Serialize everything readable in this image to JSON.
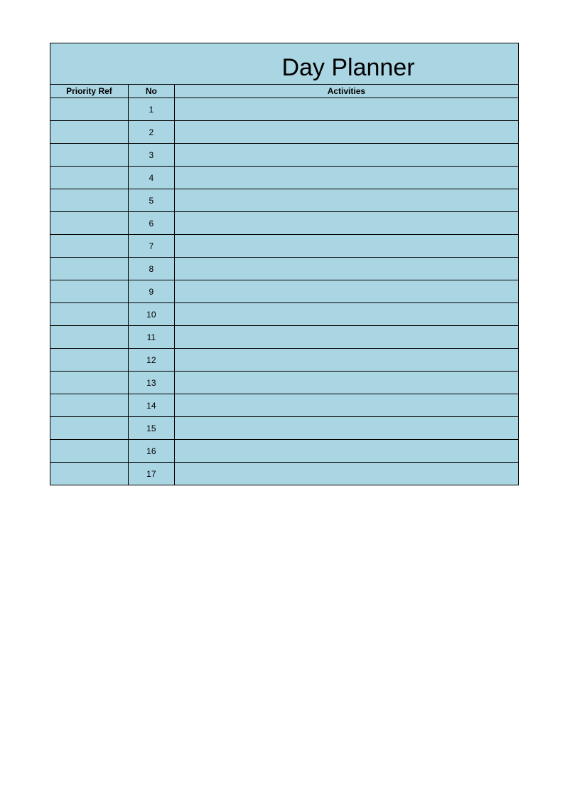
{
  "title": "Day Planner",
  "columns": {
    "priority": "Priority Ref",
    "no": "No",
    "activities": "Activities"
  },
  "rows": [
    {
      "priority": "",
      "no": "1",
      "activities": ""
    },
    {
      "priority": "",
      "no": "2",
      "activities": ""
    },
    {
      "priority": "",
      "no": "3",
      "activities": ""
    },
    {
      "priority": "",
      "no": "4",
      "activities": ""
    },
    {
      "priority": "",
      "no": "5",
      "activities": ""
    },
    {
      "priority": "",
      "no": "6",
      "activities": ""
    },
    {
      "priority": "",
      "no": "7",
      "activities": ""
    },
    {
      "priority": "",
      "no": "8",
      "activities": ""
    },
    {
      "priority": "",
      "no": "9",
      "activities": ""
    },
    {
      "priority": "",
      "no": "10",
      "activities": ""
    },
    {
      "priority": "",
      "no": "11",
      "activities": ""
    },
    {
      "priority": "",
      "no": "12",
      "activities": ""
    },
    {
      "priority": "",
      "no": "13",
      "activities": ""
    },
    {
      "priority": "",
      "no": "14",
      "activities": ""
    },
    {
      "priority": "",
      "no": "15",
      "activities": ""
    },
    {
      "priority": "",
      "no": "16",
      "activities": ""
    },
    {
      "priority": "",
      "no": "17",
      "activities": ""
    }
  ]
}
